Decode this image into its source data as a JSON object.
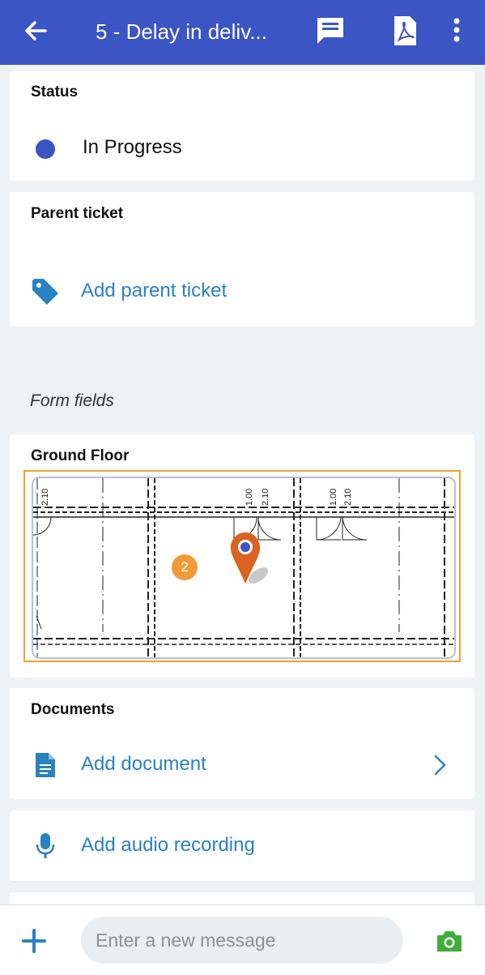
{
  "header": {
    "title": "5 - Delay in deliv...",
    "icons": [
      "back-arrow-icon",
      "comment-icon",
      "pdf-icon",
      "more-vertical-icon"
    ],
    "color": "#3b55c4"
  },
  "status": {
    "label": "Status",
    "value": "In Progress",
    "color": "#3b55c4"
  },
  "parent_ticket": {
    "label": "Parent ticket",
    "action": "Add parent ticket",
    "icon": "tag-icon"
  },
  "form_fields": {
    "label": "Form fields"
  },
  "floor_plan": {
    "label": "Ground Floor",
    "marker_count": "2",
    "dimension_labels": [
      "2.10",
      "1.00",
      "2.10",
      "1.00",
      "2.10"
    ],
    "pin_icon": "map-pin-icon",
    "accent": "#f29a38"
  },
  "documents": {
    "label": "Documents",
    "action": "Add document",
    "icon": "document-icon"
  },
  "audio": {
    "action": "Add audio recording",
    "icon": "microphone-icon"
  },
  "composer": {
    "placeholder": "Enter a new message",
    "icons": [
      "plus-icon",
      "camera-icon"
    ]
  },
  "link_color": "#2a82c0"
}
